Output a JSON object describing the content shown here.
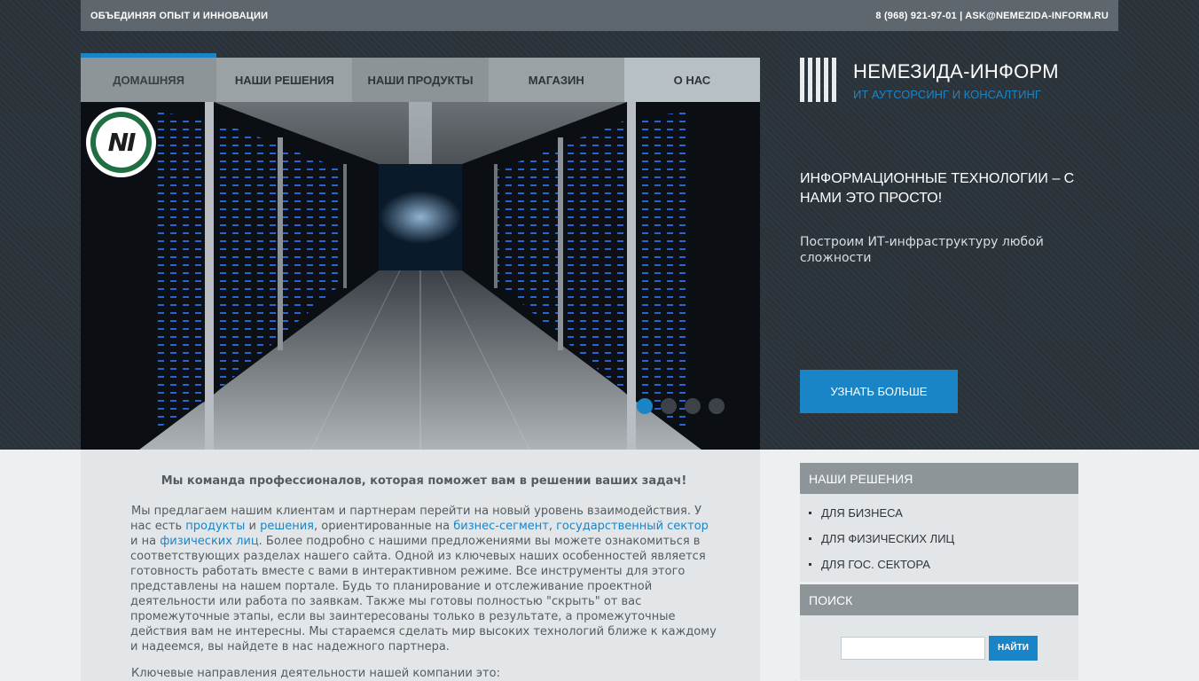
{
  "topbar": {
    "slogan": "ОБЪЕДИНЯЯ ОПЫТ И ИННОВАЦИИ",
    "contacts": "8 (968) 921-97-01 | ASK@NEMEZIDA-INFORM.RU"
  },
  "nav": {
    "items": [
      {
        "label": "ДОМАШНЯЯ"
      },
      {
        "label": "НАШИ РЕШЕНИЯ"
      },
      {
        "label": "НАШИ ПРОДУКТЫ"
      },
      {
        "label": "МАГАЗИН"
      },
      {
        "label": "О НАС"
      }
    ]
  },
  "slider": {
    "logo_text": "NI",
    "dots": 4,
    "active_dot": 0
  },
  "brand": {
    "name": "НЕМЕЗИДА-ИНФОРМ",
    "tagline": "ИТ АУТСОРСИНГ И КОНСАЛТИНГ"
  },
  "hero": {
    "heading": "ИНФОРМАЦИОННЫЕ ТЕХНОЛОГИИ – С НАМИ ЭТО ПРОСТО!",
    "text": "Построим ИТ-инфраструктуру любой сложности",
    "cta": "УЗНАТЬ БОЛЬШЕ"
  },
  "main": {
    "title": "Мы команда профессионалов, которая поможет вам в решении ваших задач!",
    "p1": {
      "t1": "Мы предлагаем нашим клиентам и партнерам перейти на новый уровень взаимодействия. У нас есть ",
      "l1": "продукты",
      "t2": " и ",
      "l2": "решения",
      "t3": ", ориентированные на ",
      "l3": "бизнес-сегмент",
      "t4": ", ",
      "l4": "государственный сектор",
      "t5": " и на ",
      "l5": "физических лиц",
      "t6": ". Более подробно с нашими предложениями вы можете ознакомиться в соответствующих разделах нашего сайта. Одной из ключевых наших особенностей является готовность работать вместе с вами в интерактивном режиме. Все инструменты для этого представлены на нашем портале. Будь то планирование и отслеживание проектной деятельности или работа по заявкам. Также мы готовы полностью \"скрыть\" от вас промежуточные этапы, если вы заинтересованы только в результате, а промежуточные действия вам не интересны. Мы стараемся сделать мир высоких технологий ближе к каждому и надеемся, вы найдете в нас надежного партнера."
    },
    "p2": "Ключевые направления деятельности нашей компании это:"
  },
  "sidebar": {
    "solutions": {
      "title": "НАШИ РЕШЕНИЯ",
      "items": [
        {
          "label": "ДЛЯ БИЗНЕСА"
        },
        {
          "label": "ДЛЯ ФИЗИЧЕСКИХ ЛИЦ"
        },
        {
          "label": "ДЛЯ ГОС. СЕКТОРА"
        }
      ]
    },
    "search": {
      "title": "ПОИСК",
      "placeholder": "",
      "button": "НАЙТИ"
    }
  },
  "colors": {
    "accent": "#1a85c6",
    "header_bg": "#2b333a",
    "topbar_bg": "#5e676e",
    "nav_gray": "#8d9599",
    "content_bg": "#e3e6e8"
  }
}
